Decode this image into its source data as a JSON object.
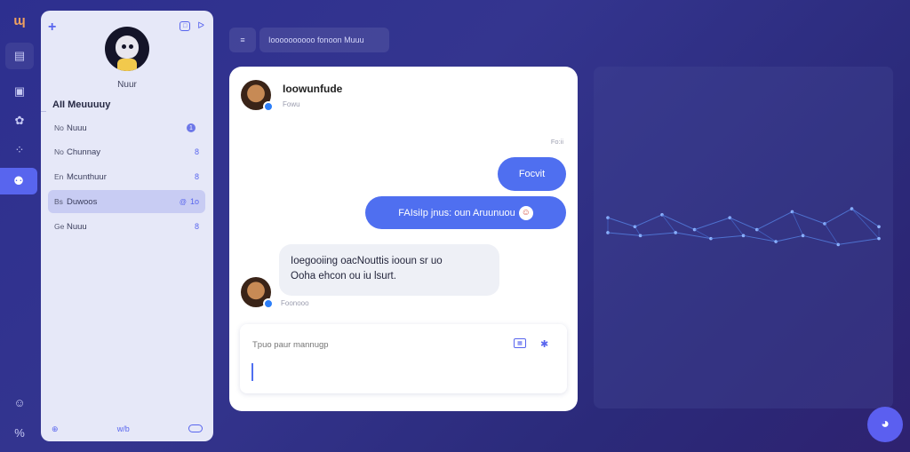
{
  "app": {
    "logo": "ɰ"
  },
  "rail": {
    "icons": [
      "logo-icon",
      "document-icon",
      "grid-icon",
      "palette-icon",
      "apps-icon",
      "chat-icon",
      "bot-icon",
      "percent-icon"
    ]
  },
  "sidebar": {
    "plus": "+",
    "profile_name": "Nuur",
    "section_title": "AII Meuuuuy",
    "items": [
      {
        "pre": "No",
        "label": "Nuuu",
        "count": "",
        "dot": "1"
      },
      {
        "pre": "No",
        "label": "Chunnay",
        "count": "8",
        "dot": ""
      },
      {
        "pre": "En",
        "label": "Mcunthuur",
        "count": "8",
        "dot": ""
      },
      {
        "pre": "Bs",
        "label": "Duwoos",
        "count": "1o",
        "dot": "@"
      },
      {
        "pre": "Ge",
        "label": "Nuuu",
        "count": "8",
        "dot": ""
      }
    ],
    "bottom_left": "⊕",
    "bottom_mid": "w/b"
  },
  "header": {
    "chip_menu": "≡",
    "chip_title": "Ioooooooooo fonoon Muuu"
  },
  "chat": {
    "contact_name": "Ioowunfude",
    "contact_status": "Fowu",
    "timestamp": "Fo:ii",
    "msg_out_1": "Focvit",
    "msg_out_2": "FAIsiIp jnus: oun Aruunuou",
    "msg_out_2_emoji": "☺",
    "msg_in_line1": "Ioegooiing oacNouttis iooun sr uo",
    "msg_in_line2": "Ooha ehcon ou iu lsurt.",
    "msg_in_sub": "Foonooo",
    "composer_placeholder": "Tpuo paur mannugp"
  },
  "colors": {
    "accent": "#5865ee",
    "bubble": "#4f6ff0",
    "background": "#2d2f8f"
  },
  "network": {
    "nodes_a": [
      [
        0,
        0.12
      ],
      [
        0.1,
        0.18
      ],
      [
        0.2,
        0.1
      ],
      [
        0.32,
        0.2
      ],
      [
        0.45,
        0.12
      ],
      [
        0.55,
        0.2
      ],
      [
        0.68,
        0.08
      ],
      [
        0.8,
        0.16
      ],
      [
        0.9,
        0.06
      ],
      [
        1,
        0.18
      ]
    ],
    "nodes_b": [
      [
        0,
        0.22
      ],
      [
        0.12,
        0.24
      ],
      [
        0.25,
        0.22
      ],
      [
        0.38,
        0.26
      ],
      [
        0.5,
        0.24
      ],
      [
        0.62,
        0.28
      ],
      [
        0.72,
        0.24
      ],
      [
        0.85,
        0.3
      ],
      [
        1,
        0.26
      ]
    ]
  }
}
